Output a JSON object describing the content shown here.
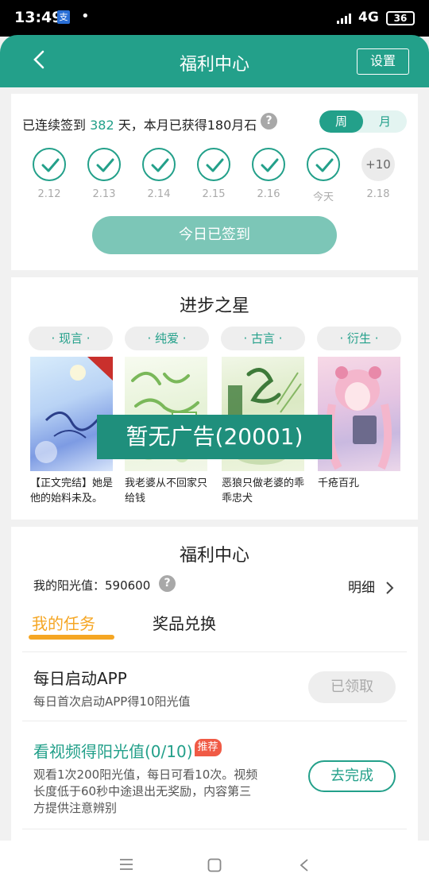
{
  "status_bar": {
    "time": "13:49",
    "app_badge": "支",
    "dot": "•",
    "network": "4G",
    "battery": "36"
  },
  "header": {
    "title": "福利中心",
    "settings_label": "设置"
  },
  "checkin": {
    "prefix": "已连续签到",
    "days": "382",
    "suffix": "天，本月已获得180月石",
    "toggle": {
      "week": "周",
      "month": "月"
    },
    "day_items": [
      {
        "label": "2.12"
      },
      {
        "label": "2.13"
      },
      {
        "label": "2.14"
      },
      {
        "label": "2.15"
      },
      {
        "label": "2.16"
      },
      {
        "label": "今天"
      },
      {
        "label": "2.18",
        "reward": "+10"
      }
    ],
    "button_label": "今日已签到"
  },
  "progress_star": {
    "title": "进步之星",
    "categories": [
      "· 现言 ·",
      "· 纯爱 ·",
      "· 古言 ·",
      "· 衍生 ·"
    ],
    "books": [
      {
        "name": "【正文完结】她是他的始料未及。"
      },
      {
        "name": "我老婆从不回家只给钱"
      },
      {
        "name": "恶狼只做老婆的乖乖忠犬"
      },
      {
        "name": "千疮百孔"
      }
    ]
  },
  "ad_banner": "暂无广告(20001)",
  "welfare": {
    "title": "福利中心",
    "sunshine_label": "我的阳光值：590600",
    "detail_label": "明细",
    "tabs": {
      "active": "我的任务",
      "other": "奖品兑换"
    },
    "tasks": [
      {
        "title": "每日启动APP",
        "desc": "每日首次启动APP得10阳光值",
        "button": "已领取"
      },
      {
        "title": "看视频得阳光值(0/10)",
        "badge": "推荐",
        "desc_lines": [
          "观看1次200阳光值，每日可看10次。视频",
          "长度低于60秒中途退出无奖励，内容第三",
          "方提供注意辨别"
        ],
        "button": "去完成"
      }
    ]
  },
  "colors": {
    "primary": "#23a08a",
    "accent": "#f5a623",
    "badge": "#f05a45"
  },
  "nav_icons": [
    "menu-icon",
    "home-square-icon",
    "back-triangle-icon"
  ]
}
